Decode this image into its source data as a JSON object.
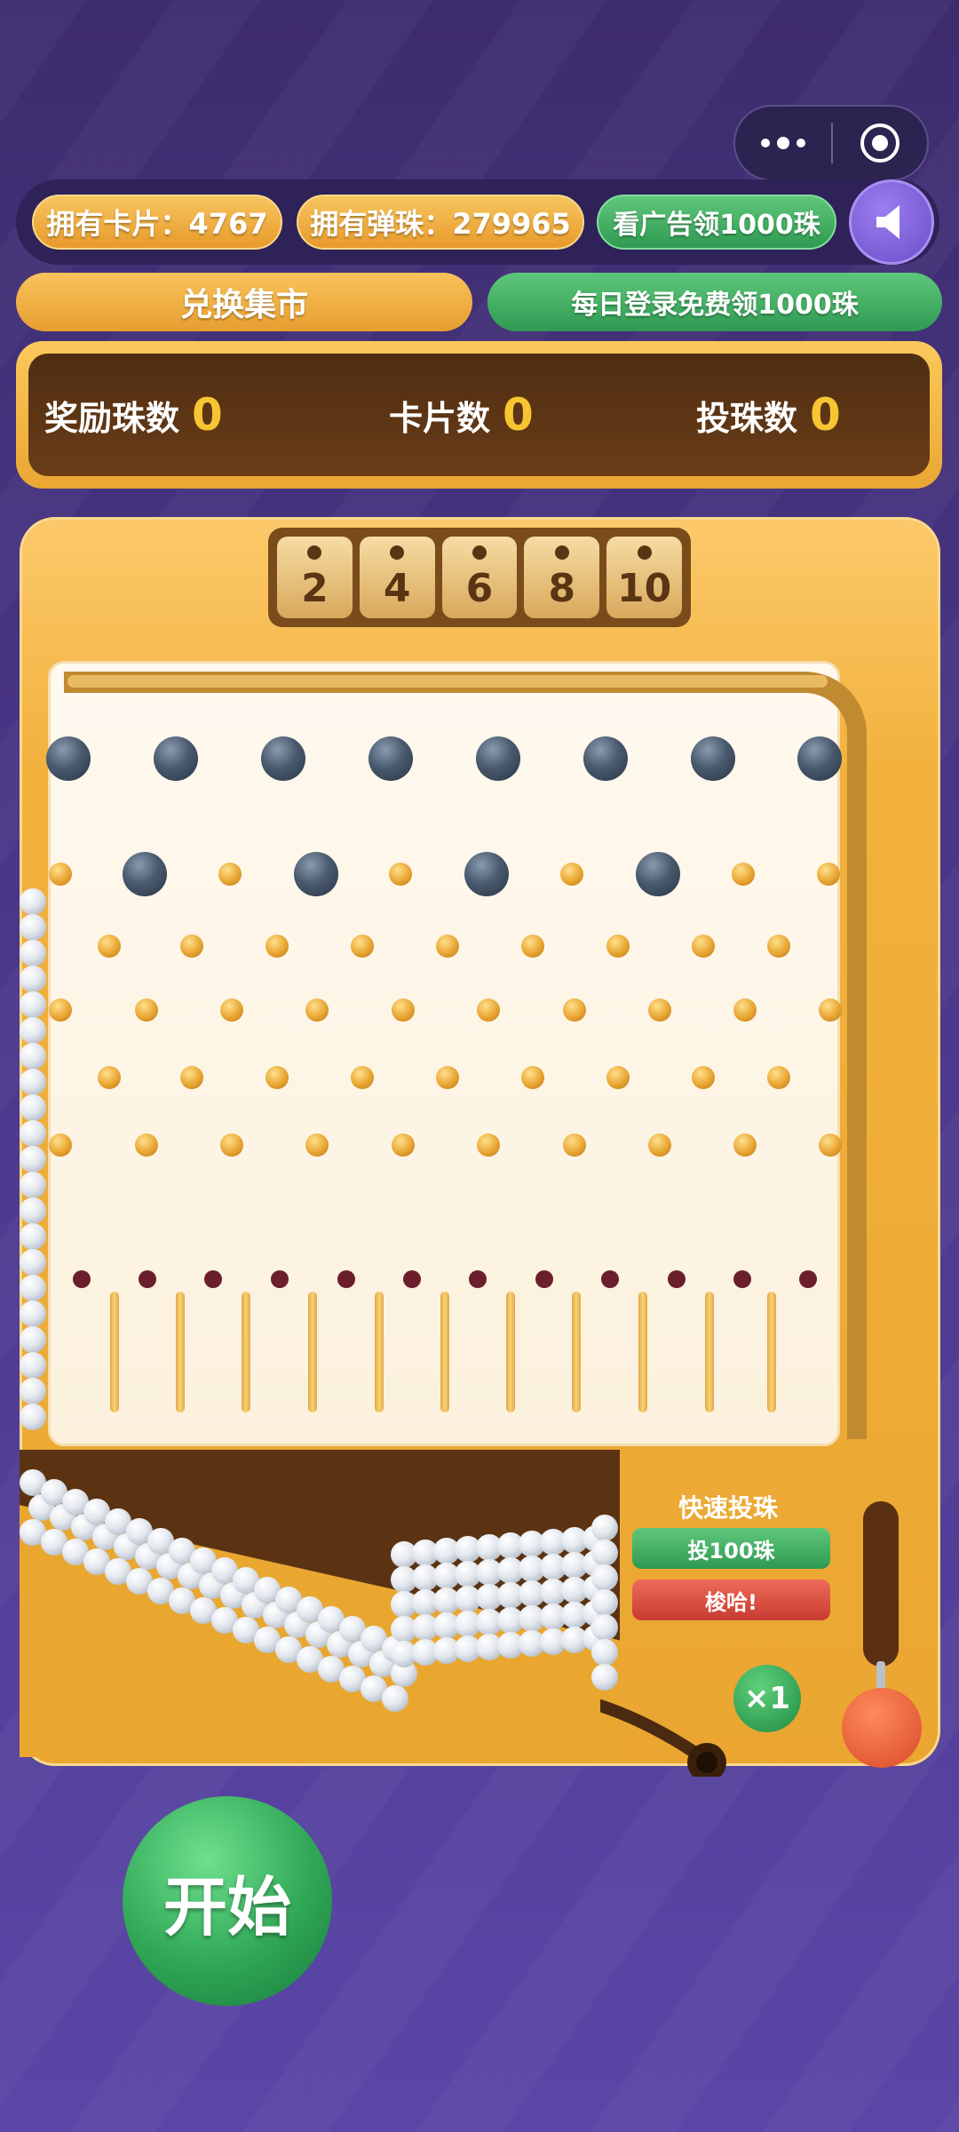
{
  "header": {
    "cards_label": "拥有卡片：4767",
    "marbles_label": "拥有弹珠：279965",
    "ad_label": "看广告领1000珠"
  },
  "actions": {
    "exchange_label": "兑换集市",
    "daily_label": "每日登录免费领1000珠"
  },
  "scoreboard": {
    "reward_label": "奖励珠数",
    "reward_value": "0",
    "cards_label": "卡片数",
    "cards_value": "0",
    "thrown_label": "投珠数",
    "thrown_value": "0"
  },
  "slots": [
    "2",
    "4",
    "6",
    "8",
    "10"
  ],
  "panel": {
    "title": "快速投珠",
    "throw100_label": "投100珠",
    "shuffle_label": "梭哈!",
    "multiplier": "×1"
  },
  "start_label": "开始",
  "colors": {
    "gold": "#f2b13d",
    "green": "#2f9a52",
    "red": "#d9463b",
    "purple_bg": "#4a3688"
  },
  "icons": [
    "more-icon",
    "target-icon",
    "speaker-icon"
  ]
}
